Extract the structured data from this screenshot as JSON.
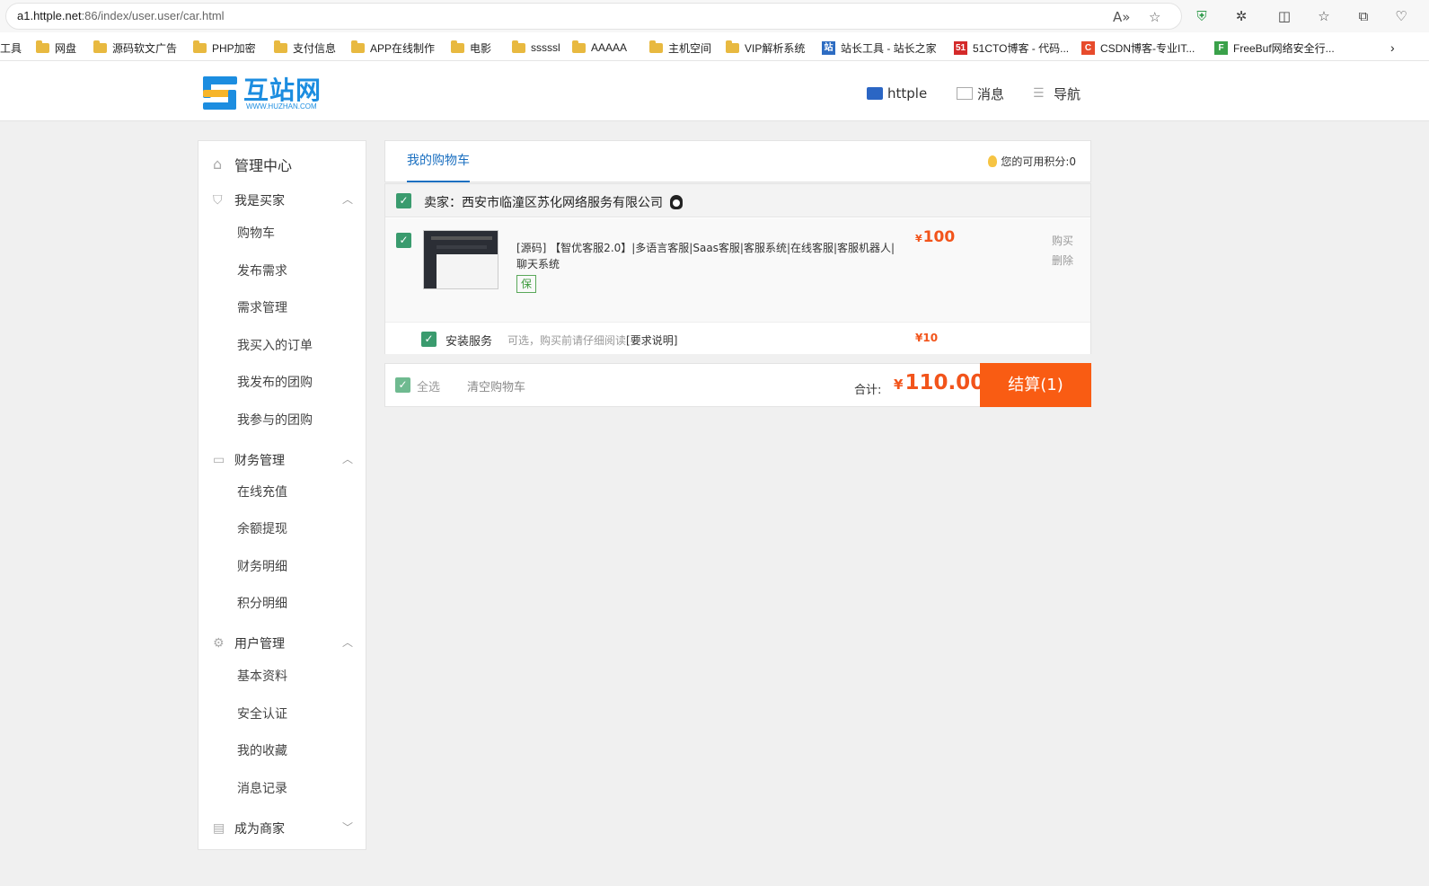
{
  "browser": {
    "url_host": "a1.httple.net",
    "url_rest": ":86/index/user.user/car.html",
    "bookmarks": [
      {
        "label": "工具",
        "type": "none"
      },
      {
        "label": "网盘",
        "type": "folder"
      },
      {
        "label": "源码软文广告",
        "type": "folder"
      },
      {
        "label": "PHP加密",
        "type": "folder"
      },
      {
        "label": "支付信息",
        "type": "folder"
      },
      {
        "label": "APP在线制作",
        "type": "folder"
      },
      {
        "label": "电影",
        "type": "folder"
      },
      {
        "label": "sssssl",
        "type": "folder"
      },
      {
        "label": "AAAAA",
        "type": "folder"
      },
      {
        "label": "主机空间",
        "type": "folder"
      },
      {
        "label": "VIP解析系统",
        "type": "folder"
      },
      {
        "label": "站长工具 - 站长之家",
        "type": "site",
        "fav": "站",
        "color": "#2d6cc2"
      },
      {
        "label": "51CTO博客 - 代码...",
        "type": "site",
        "fav": "51",
        "color": "#d42a2a"
      },
      {
        "label": "CSDN博客-专业IT...",
        "type": "site",
        "fav": "C",
        "color": "#e74b2c"
      },
      {
        "label": "FreeBuf网络安全行...",
        "type": "site",
        "fav": "F",
        "color": "#3aa14a"
      }
    ]
  },
  "header": {
    "logo_text": "互站网",
    "logo_sub": "WWW.HUZHAN.COM",
    "nav": {
      "user": "httple",
      "messages": "消息",
      "navigation": "导航"
    }
  },
  "sidebar": {
    "title": "管理中心",
    "sections": [
      {
        "label": "我是买家",
        "items": [
          "购物车",
          "发布需求",
          "需求管理",
          "我买入的订单",
          "我发布的团购",
          "我参与的团购"
        ]
      },
      {
        "label": "财务管理",
        "items": [
          "在线充值",
          "余额提现",
          "财务明细",
          "积分明细"
        ]
      },
      {
        "label": "用户管理",
        "items": [
          "基本资料",
          "安全认证",
          "我的收藏",
          "消息记录"
        ]
      },
      {
        "label": "成为商家",
        "items": []
      }
    ]
  },
  "cart": {
    "tab": "我的购物车",
    "points_label": "您的可用积分:0",
    "seller": "卖家：西安市临潼区苏化网络服务有限公司",
    "item": {
      "title": "[源码] 【智优客服2.0】|多语言客服|Saas客服|客服系统|在线客服|客服机器人|聊天系统",
      "badge": "保",
      "currency": "¥",
      "price": "100",
      "buy": "购买",
      "delete": "删除"
    },
    "service": {
      "label": "安装服务",
      "note": "可选，购买前请仔细阅读",
      "note_link": "[要求说明]",
      "price": "¥10"
    },
    "footer": {
      "select_all": "全选",
      "clear": "清空购物车",
      "total_label": "合计:",
      "currency": "¥",
      "total": "110.00",
      "checkout": "结算(1)"
    }
  },
  "colors": {
    "accent": "#f95c13",
    "price": "#f2541b",
    "link": "#1a6fc0",
    "check": "#3a9b6e"
  }
}
